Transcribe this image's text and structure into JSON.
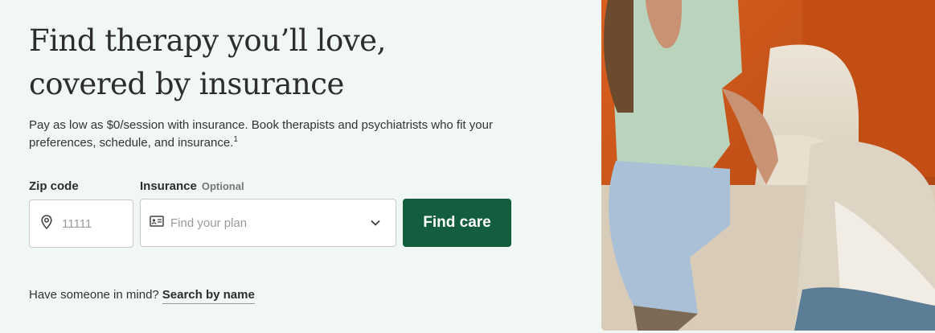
{
  "hero": {
    "headline_line1": "Find therapy you’ll love,",
    "headline_line2": "covered by insurance",
    "subtext": "Pay as low as $0/session with insurance. Book therapists and psychiatrists who fit your preferences, schedule, and insurance.",
    "footnote_marker": "1"
  },
  "form": {
    "zip_label": "Zip code",
    "zip_placeholder": "11111",
    "insurance_label": "Insurance",
    "insurance_optional": "Optional",
    "insurance_placeholder": "Find your plan",
    "submit_label": "Find care"
  },
  "footer_prompt": {
    "text": "Have someone in mind?",
    "link_label": "Search by name"
  },
  "colors": {
    "background": "#f0f7f4",
    "primary_button": "#125e3f"
  },
  "icons": {
    "zip": "map-pin-icon",
    "insurance": "id-card-icon",
    "dropdown": "chevron-down-icon"
  }
}
